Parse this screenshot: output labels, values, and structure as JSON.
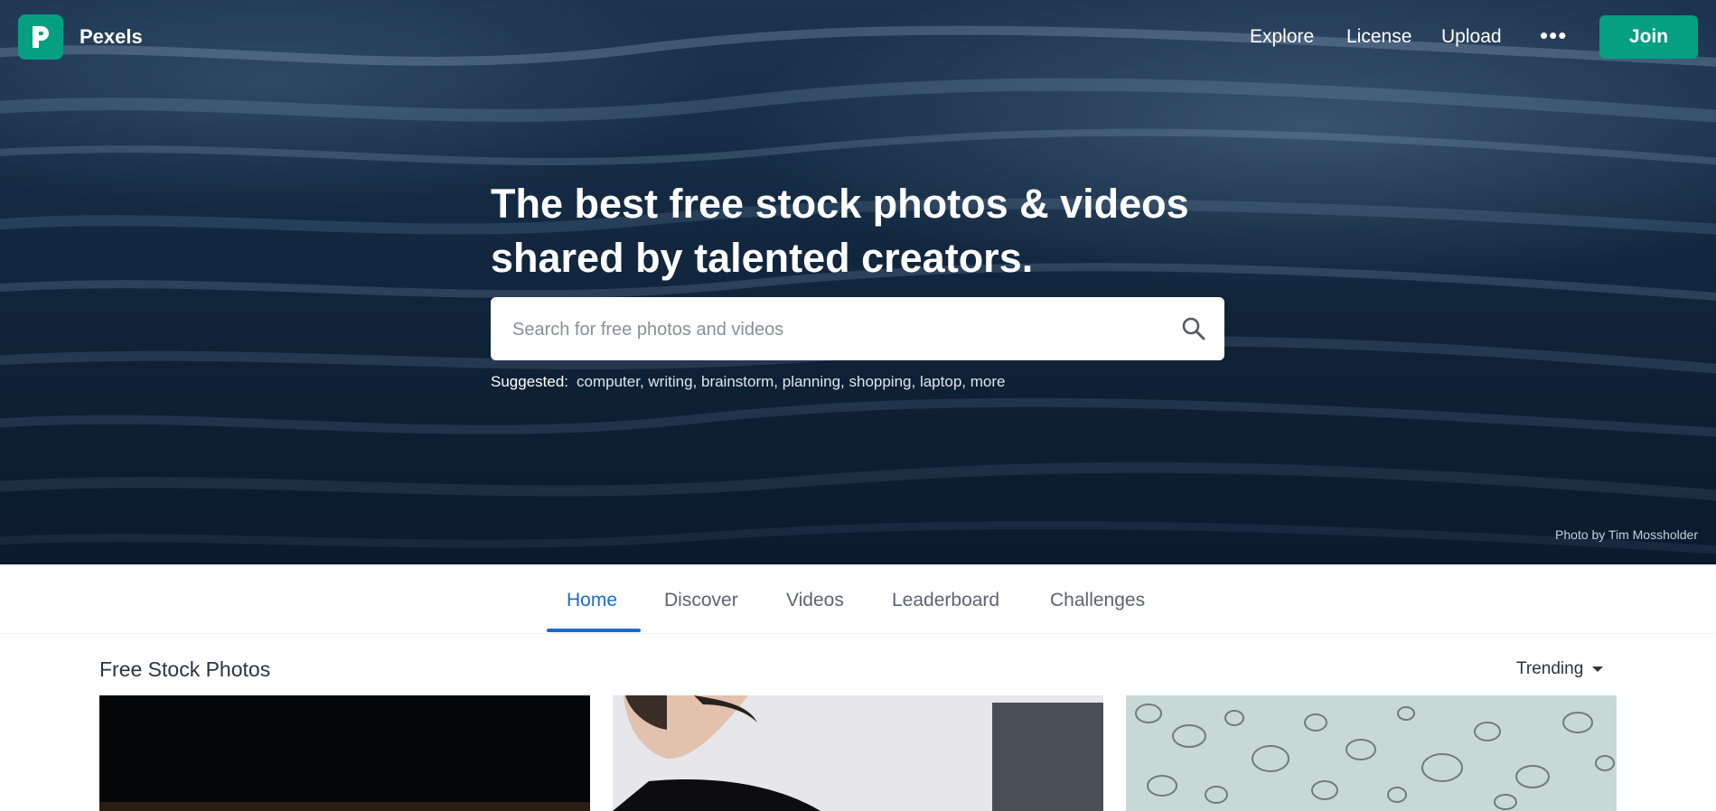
{
  "header": {
    "brand": "Pexels",
    "logo_icon": "pexels-logo-icon",
    "nav": [
      "Explore",
      "License",
      "Upload"
    ],
    "more_icon": "more-dots-icon",
    "join_label": "Join"
  },
  "hero": {
    "headline_line1": "The best free stock photos & videos",
    "headline_line2": "shared by talented creators.",
    "search_placeholder": "Search for free photos and videos",
    "search_icon": "search-icon",
    "suggested_label": "Suggested:",
    "suggested": [
      "computer",
      "writing",
      "brainstorm",
      "planning",
      "shopping",
      "laptop",
      "more"
    ],
    "credit": "Photo by Tim Mossholder"
  },
  "tabs": [
    {
      "label": "Home",
      "active": true
    },
    {
      "label": "Discover",
      "active": false
    },
    {
      "label": "Videos",
      "active": false
    },
    {
      "label": "Leaderboard",
      "active": false
    },
    {
      "label": "Challenges",
      "active": false
    }
  ],
  "section": {
    "title": "Free Stock Photos",
    "sort_value": "Trending",
    "sort_icon": "caret-down-icon"
  },
  "colors": {
    "brand_green": "#05a081",
    "tab_active": "#1a6bcf"
  }
}
